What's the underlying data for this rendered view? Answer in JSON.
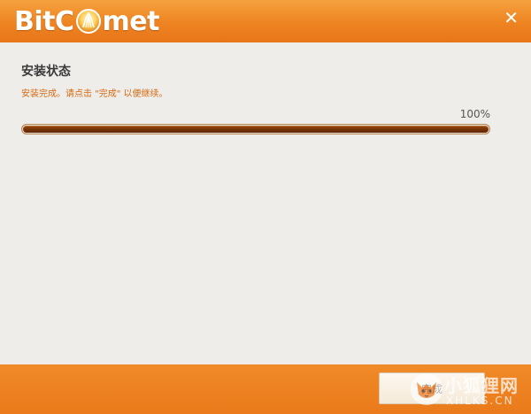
{
  "app": {
    "logo_left": "BitC",
    "logo_right": "met",
    "close_glyph": "✕",
    "logo_orb_icon": "comet-orb-icon"
  },
  "install": {
    "title": "安装状态",
    "subtitle": "安装完成。请点击 \"完成\" 以便继续。",
    "progress_label": "100%",
    "progress": 1.0
  },
  "footer": {
    "finish_label": "完成"
  },
  "watermark": {
    "cn": "小狐狸网",
    "en": "XHLKS.CN",
    "icon": "fox-logo-icon"
  },
  "colors": {
    "accent": "#ee8321",
    "progress_fill": "#7a3305",
    "subtitle": "#d66a12"
  }
}
